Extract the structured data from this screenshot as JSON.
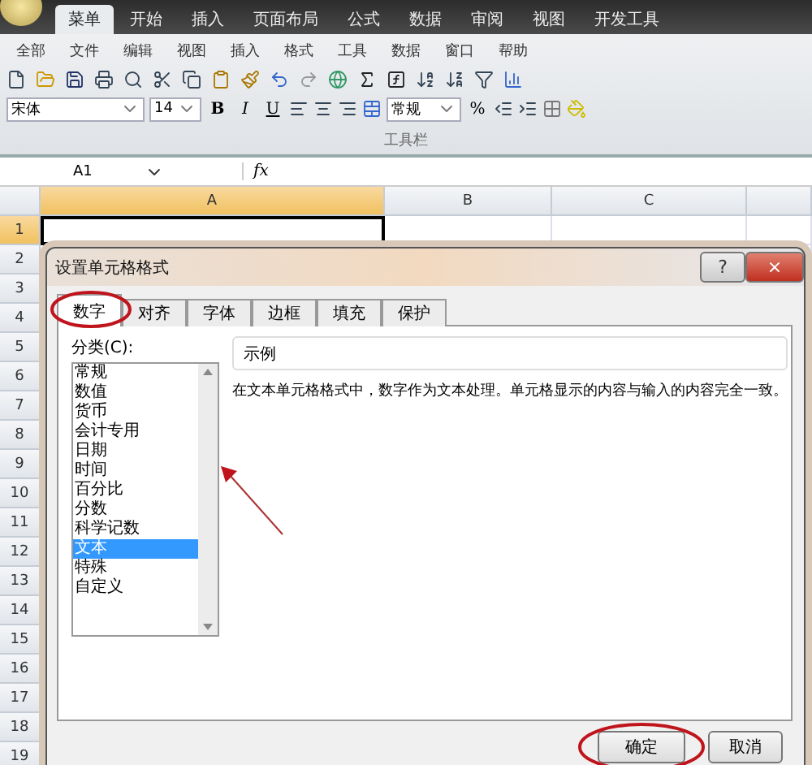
{
  "ribbon_tabs": [
    {
      "label": "菜单",
      "selected": true
    },
    {
      "label": "开始",
      "selected": false
    },
    {
      "label": "插入",
      "selected": false
    },
    {
      "label": "页面布局",
      "selected": false
    },
    {
      "label": "公式",
      "selected": false
    },
    {
      "label": "数据",
      "selected": false
    },
    {
      "label": "审阅",
      "selected": false
    },
    {
      "label": "视图",
      "selected": false
    },
    {
      "label": "开发工具",
      "selected": false
    }
  ],
  "menu_bar": [
    "全部",
    "文件",
    "编辑",
    "视图",
    "插入",
    "格式",
    "工具",
    "数据",
    "窗口",
    "帮助"
  ],
  "toolbar": {
    "font": "宋体",
    "size": "14",
    "bold": "B",
    "italic": "I",
    "underline": "U",
    "number_format": "常规",
    "percent": "%",
    "group_label": "工具栏"
  },
  "formula_bar": {
    "name_box": "A1",
    "function_label": "fx"
  },
  "sheet": {
    "columns": [
      {
        "label": "A",
        "selected": true
      },
      {
        "label": "B",
        "selected": false
      },
      {
        "label": "C",
        "selected": false
      }
    ],
    "rows": [
      {
        "label": "1",
        "selected": true
      },
      {
        "label": "2",
        "selected": false
      },
      {
        "label": "3",
        "selected": false
      },
      {
        "label": "4",
        "selected": false
      },
      {
        "label": "5",
        "selected": false
      },
      {
        "label": "6",
        "selected": false
      },
      {
        "label": "7",
        "selected": false
      },
      {
        "label": "8",
        "selected": false
      },
      {
        "label": "9",
        "selected": false
      },
      {
        "label": "10",
        "selected": false
      },
      {
        "label": "11",
        "selected": false
      },
      {
        "label": "12",
        "selected": false
      },
      {
        "label": "13",
        "selected": false
      },
      {
        "label": "14",
        "selected": false
      },
      {
        "label": "15",
        "selected": false
      },
      {
        "label": "16",
        "selected": false
      },
      {
        "label": "17",
        "selected": false
      },
      {
        "label": "18",
        "selected": false
      },
      {
        "label": "19",
        "selected": false
      }
    ]
  },
  "dialog": {
    "title": "设置单元格格式",
    "help": "?",
    "close": "×",
    "tabs": [
      {
        "label": "数字",
        "selected": true,
        "circled": true
      },
      {
        "label": "对齐",
        "selected": false,
        "circled": false
      },
      {
        "label": "字体",
        "selected": false,
        "circled": false
      },
      {
        "label": "边框",
        "selected": false,
        "circled": false
      },
      {
        "label": "填充",
        "selected": false,
        "circled": false
      },
      {
        "label": "保护",
        "selected": false,
        "circled": false
      }
    ],
    "category_label": "分类(C):",
    "categories": [
      {
        "label": "常规",
        "selected": false
      },
      {
        "label": "数值",
        "selected": false
      },
      {
        "label": "货币",
        "selected": false
      },
      {
        "label": "会计专用",
        "selected": false
      },
      {
        "label": "日期",
        "selected": false
      },
      {
        "label": "时间",
        "selected": false
      },
      {
        "label": "百分比",
        "selected": false
      },
      {
        "label": "分数",
        "selected": false
      },
      {
        "label": "科学记数",
        "selected": false
      },
      {
        "label": "文本",
        "selected": true
      },
      {
        "label": "特殊",
        "selected": false
      },
      {
        "label": "自定义",
        "selected": false
      }
    ],
    "sample_label": "示例",
    "description": "在文本单元格格式中，数字作为文本处理。单元格显示的内容与输入的内容完全一致。",
    "buttons": [
      {
        "label": "确定",
        "circled": true
      },
      {
        "label": "取消",
        "circled": false
      }
    ]
  }
}
